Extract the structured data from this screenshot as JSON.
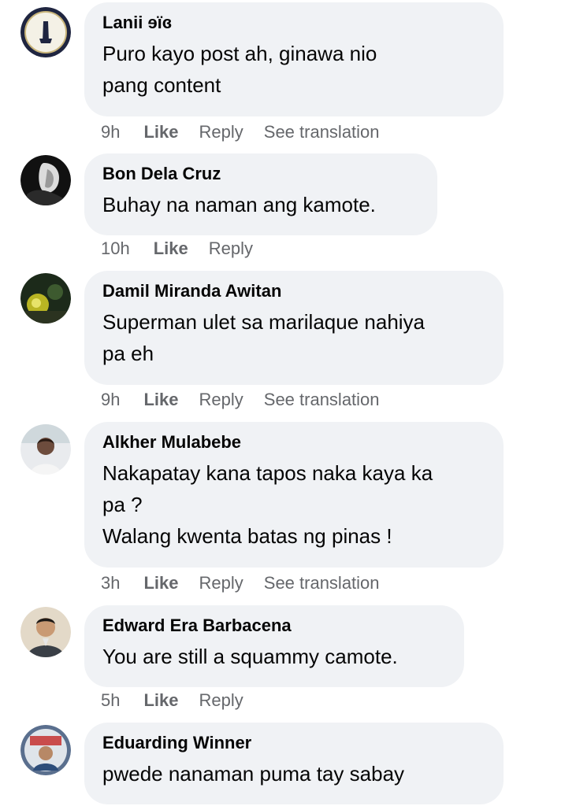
{
  "comments": [
    {
      "name": "Lanii ɘïɞ",
      "text": "Puro kayo post ah, ginawa nio\npang content",
      "time": "9h",
      "like": "Like",
      "reply": "Reply",
      "translate": "See translation",
      "avatar_icon": "avatar-badge-icon"
    },
    {
      "name": "Bon Dela Cruz",
      "text": "Buhay na naman ang kamote.",
      "time": "10h",
      "like": "Like",
      "reply": "Reply",
      "avatar_icon": "avatar-photo-icon"
    },
    {
      "name": "Damil Miranda Awitan",
      "text": "Superman ulet sa marilaque nahiya\npa eh",
      "time": "9h",
      "like": "Like",
      "reply": "Reply",
      "translate": "See translation",
      "avatar_icon": "avatar-photo-icon"
    },
    {
      "name": "Alkher Mulabebe",
      "text": "Nakapatay kana tapos naka kaya ka\npa ?\nWalang kwenta batas ng pinas !",
      "time": "3h",
      "like": "Like",
      "reply": "Reply",
      "translate": "See translation",
      "avatar_icon": "avatar-photo-icon"
    },
    {
      "name": "Edward Era Barbacena",
      "text": "You are still a squammy camote.",
      "time": "5h",
      "like": "Like",
      "reply": "Reply",
      "avatar_icon": "avatar-photo-icon"
    },
    {
      "name": "Eduarding Winner",
      "text": "pwede nanaman puma tay sabay",
      "avatar_icon": "avatar-photo-icon"
    }
  ],
  "colors": {
    "bubble": "#f0f2f5",
    "action_text": "#65676b",
    "name_text": "#050505"
  }
}
